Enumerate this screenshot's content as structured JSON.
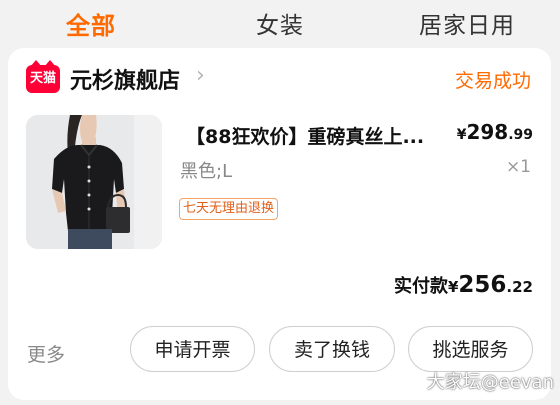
{
  "tabs": [
    {
      "label": "全部",
      "active": true
    },
    {
      "label": "女装",
      "active": false
    },
    {
      "label": "居家日用",
      "active": false
    }
  ],
  "order": {
    "shop_logo_text": "天猫",
    "shop_name": "元杉旗舰店",
    "chevron": "›",
    "status": "交易成功",
    "product": {
      "title": "【88狂欢价】重磅真丝上...",
      "price_symbol": "¥",
      "price_int": "298",
      "price_dec": ".99",
      "variant": "黑色;L",
      "quantity": "×1",
      "service_tag": "七天无理由退换"
    },
    "paid": {
      "label": "实付款",
      "symbol": "¥",
      "int": "256",
      "dec": ".22"
    },
    "more_label": "更多",
    "buttons": [
      "申请开票",
      "卖了换钱",
      "挑选服务"
    ]
  },
  "watermark": "大家坛@eevan",
  "colors": {
    "accent": "#ff6a00",
    "tmall_red": "#ff0036",
    "background": "#f2f2f2"
  }
}
